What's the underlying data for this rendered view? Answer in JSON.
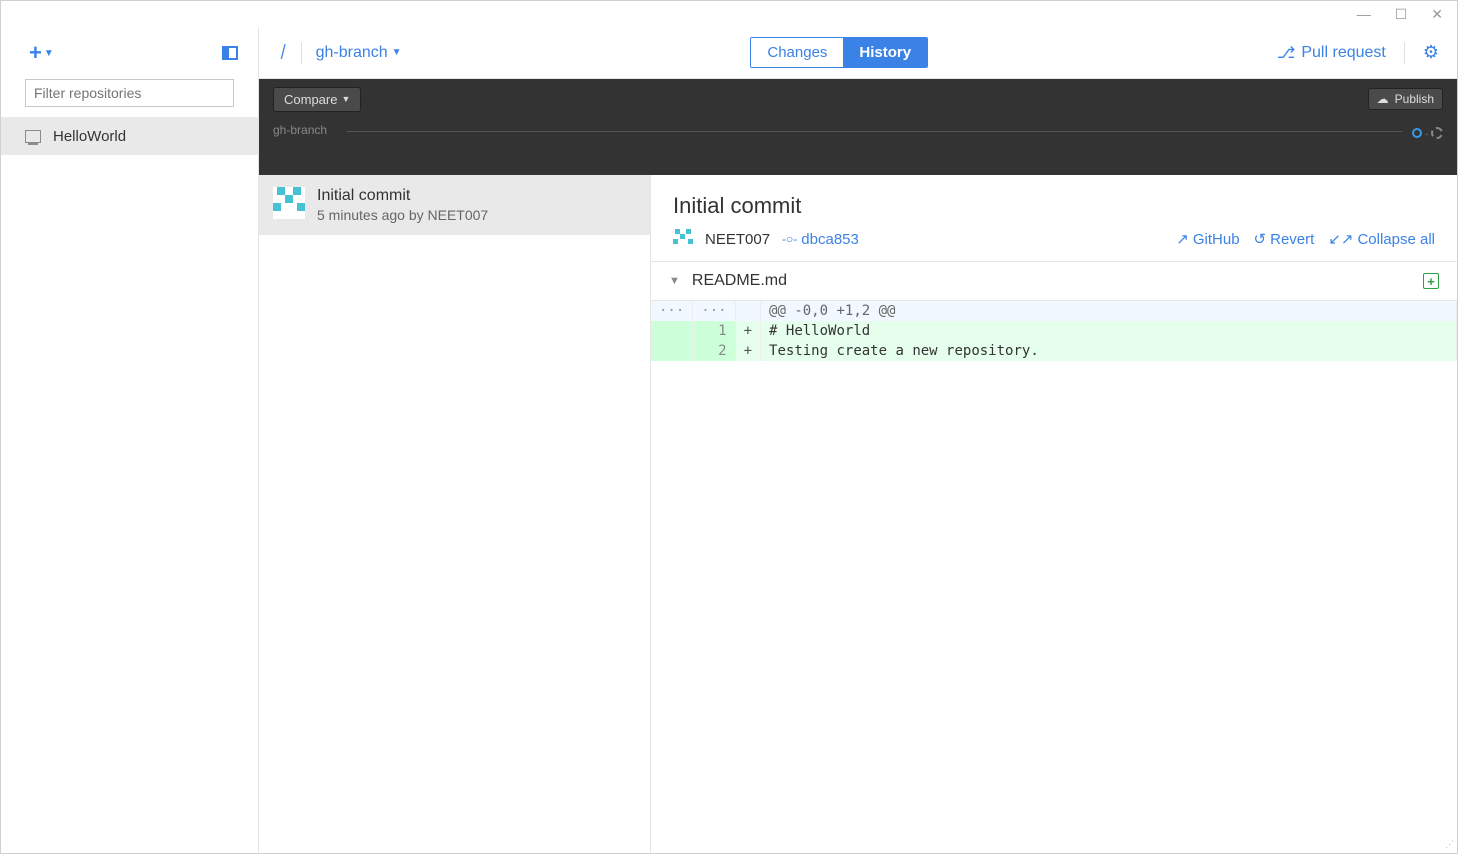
{
  "window": {
    "minimize": "—",
    "maximize": "☐",
    "close": "✕"
  },
  "sidebar": {
    "filter_placeholder": "Filter repositories",
    "repos": [
      {
        "name": "HelloWorld"
      }
    ]
  },
  "topbar": {
    "branch_name": "gh-branch",
    "tabs": {
      "changes": "Changes",
      "history": "History"
    },
    "pull_request": "Pull request"
  },
  "darkbar": {
    "compare": "Compare",
    "publish": "Publish",
    "branch_label": "gh-branch"
  },
  "commit_list": [
    {
      "title": "Initial commit",
      "meta": "5 minutes ago by NEET007"
    }
  ],
  "detail": {
    "title": "Initial commit",
    "author": "NEET007",
    "hash": "dbca853",
    "actions": {
      "github": "GitHub",
      "revert": "Revert",
      "collapse": "Collapse all"
    }
  },
  "file": {
    "name": "README.md",
    "hunk": "@@ -0,0 +1,2 @@",
    "lines": [
      {
        "new": "1",
        "sign": "+",
        "code": "# HelloWorld"
      },
      {
        "new": "2",
        "sign": "+",
        "code": "Testing create a new repository."
      }
    ]
  }
}
